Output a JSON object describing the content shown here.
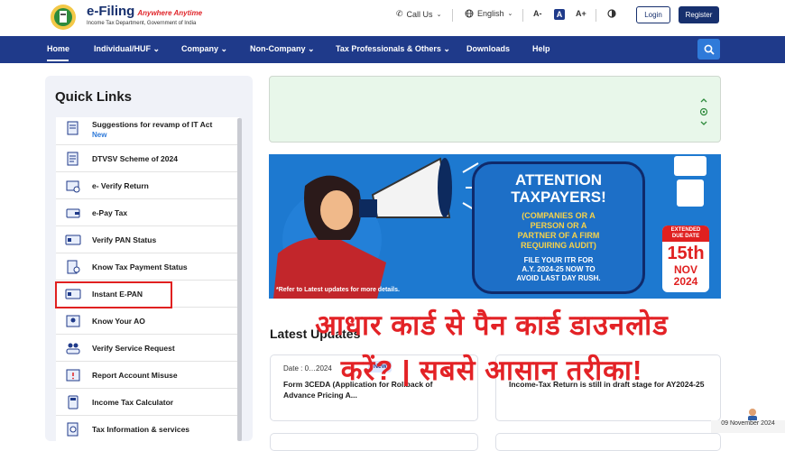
{
  "header": {
    "brand_title": "e-Filing",
    "brand_tagline": "Anywhere Anytime",
    "brand_sub": "Income Tax Department, Government of India",
    "call_us": "Call Us",
    "language": "English",
    "font_decrease": "A-",
    "font_normal": "A",
    "font_increase": "A+",
    "login_label": "Login",
    "register_label": "Register"
  },
  "nav": {
    "items": [
      {
        "label": "Home"
      },
      {
        "label": "Individual/HUF"
      },
      {
        "label": "Company"
      },
      {
        "label": "Non-Company"
      },
      {
        "label": "Tax Professionals & Others"
      },
      {
        "label": "Downloads"
      },
      {
        "label": "Help"
      }
    ]
  },
  "quick_links": {
    "title": "Quick Links",
    "items": [
      {
        "label": "Suggestions for revamp of IT Act",
        "badge": "New"
      },
      {
        "label": "DTVSV Scheme of 2024"
      },
      {
        "label": "e- Verify Return"
      },
      {
        "label": "e-Pay Tax"
      },
      {
        "label": "Verify PAN Status"
      },
      {
        "label": "Know Tax Payment Status"
      },
      {
        "label": "Instant E-PAN"
      },
      {
        "label": "Know Your AO"
      },
      {
        "label": "Verify Service Request"
      },
      {
        "label": "Report Account Misuse"
      },
      {
        "label": "Income Tax Calculator"
      },
      {
        "label": "Tax Information & services"
      }
    ]
  },
  "banner": {
    "heading1": "ATTENTION",
    "heading2": "TAXPAYERS!",
    "sub1": "(COMPANIES OR A",
    "sub2": "PERSON OR A",
    "sub3": "PARTNER OF A FIRM",
    "sub4": "REQUIRING AUDIT)",
    "file1": "FILE YOUR ITR FOR",
    "file2": "A.Y. 2024-25 NOW TO",
    "file3": "AVOID LAST DAY RUSH.",
    "refer": "*Refer to Latest updates for more details.",
    "due_label1": "EXTENDED",
    "due_label2": "DUE DATE",
    "due_day": "15th",
    "due_month": "NOV",
    "due_year": "2024"
  },
  "latest_updates": {
    "title": "Latest Updates",
    "cards": [
      {
        "date": "Date : 0…2024",
        "badge": "New",
        "title": "Form 3CEDA (Application for Rollback of Advance Pricing A..."
      },
      {
        "date": "",
        "badge": "",
        "title": "Income-Tax Return is still in draft stage for AY2024-25"
      }
    ]
  },
  "overlay": {
    "line1": "आधार कार्ड से पैन कार्ड डाउनलोड",
    "line2": "करें? | सबसे आसान तरीका!"
  },
  "footer_date": "09 November 2024",
  "colors": {
    "nav_bg": "#1f3a8a",
    "accent_blue": "#2f7ad9",
    "highlight_red": "#e02020",
    "banner_blue": "#1d79d0"
  }
}
